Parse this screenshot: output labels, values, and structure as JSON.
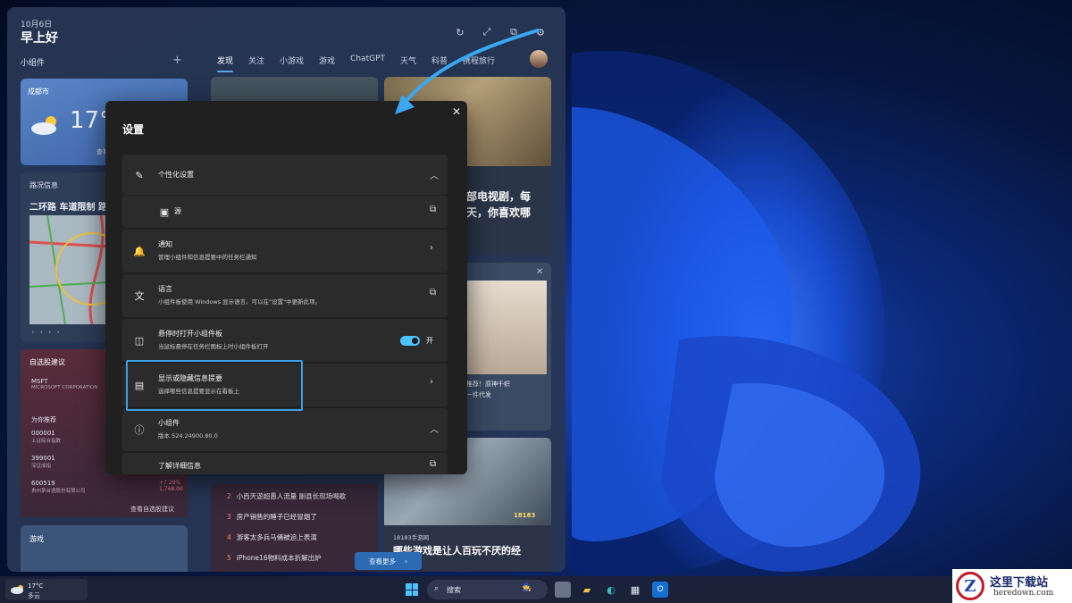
{
  "board": {
    "date": "10月6日",
    "greeting": "早上好",
    "widgets_title": "小组件",
    "tabs": [
      "发现",
      "关注",
      "小游戏",
      "游戏",
      "ChatGPT",
      "天气",
      "科普",
      "携程旅行"
    ]
  },
  "weather": {
    "city": "成都市",
    "temp": "17°C",
    "more": "查看完"
  },
  "traffic": {
    "title": "路况信息",
    "road": "二环路 车道限制 路"
  },
  "stocks": {
    "title": "自选股建议",
    "items": [
      {
        "code": "MSFT",
        "name": "MICROSOFT CORPORATION"
      },
      {
        "code": "000001",
        "name": "上证综合指数"
      },
      {
        "code": "399001",
        "name": "深证成指"
      },
      {
        "code": "600519",
        "name": "贵州茅台酒股份有限公司"
      }
    ],
    "section": "为你推荐",
    "pct": "+7.29%",
    "price": "1,748.00",
    "more": "查看自选股建议"
  },
  "games": {
    "title": "游戏"
  },
  "news": {
    "b_text": "部电视剧，每\n天，你喜欢哪",
    "c_text": "推荐！原神千织\n一件代发",
    "d_source": "18183手游网",
    "d_title": "哪些游戏是让人百玩不厌的经",
    "d_tag": "18183"
  },
  "hot_list": [
    {
      "n": "2",
      "text": "小西天遊超愚人流量 副县长现场喝歌"
    },
    {
      "n": "3",
      "text": "房产销售的睡子已经冒烟了"
    },
    {
      "n": "4",
      "text": "游客太多兵马俑被迫上表演"
    },
    {
      "n": "5",
      "text": "iPhone16物料成本折解出炉"
    }
  ],
  "more_button": "查看更多",
  "dialog": {
    "title": "设置",
    "items": [
      {
        "label": "个性化设置",
        "desc": ""
      },
      {
        "label": "源",
        "desc": ""
      },
      {
        "label": "通知",
        "desc": "管理小组件和信息提要中的任务栏通知"
      },
      {
        "label": "语言",
        "desc": "小组件板使用 Windows 显示语言。可以在\"设置\"中更新此项。"
      },
      {
        "label": "悬停时打开小组件板",
        "desc": "当鼠标悬停在任务栏图标上时小组件板打开",
        "toggle": "开"
      },
      {
        "label": "显示或隐藏信息提要",
        "desc": "选择哪些信息提要显示在看板上"
      },
      {
        "label": "小组件",
        "desc": "版本 524.24900.80.0"
      },
      {
        "label": "了解详细信息",
        "desc": ""
      }
    ]
  },
  "taskbar": {
    "temp": "17°C",
    "cond": "多云",
    "search": "搜索"
  },
  "watermark": {
    "cn": "这里下载站",
    "en": "heredown.com"
  },
  "colors": {
    "accent": "#4cc2ff",
    "highlight": "#3aa0e8",
    "dialog_bg": "#202020",
    "row_bg": "#2b2b2b"
  }
}
